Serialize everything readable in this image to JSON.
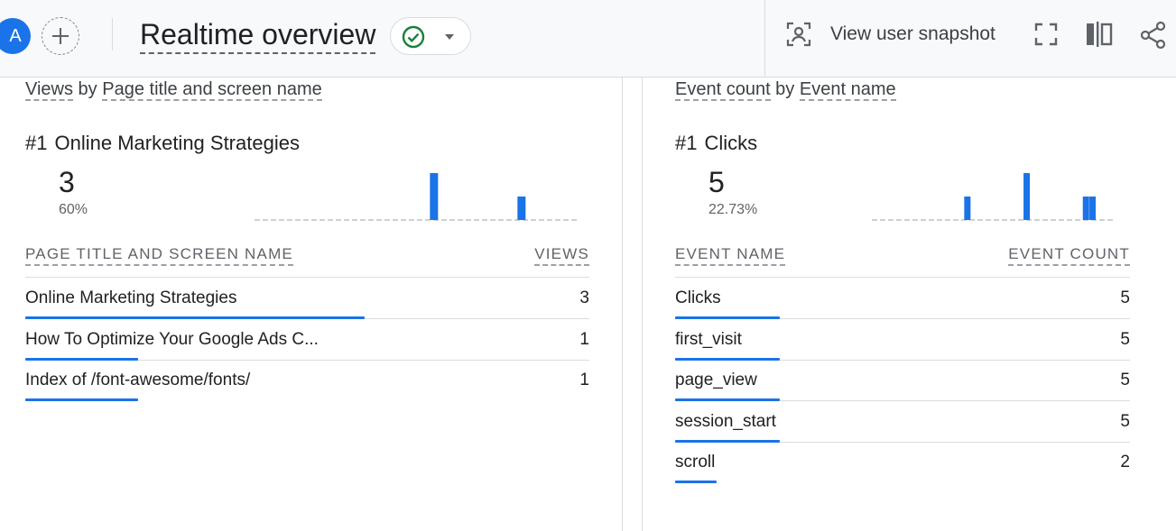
{
  "header": {
    "avatar_letter": "A",
    "title": "Realtime overview",
    "snapshot_label": "View user snapshot"
  },
  "left_card": {
    "title_part1": "Views",
    "title_part2": " by ",
    "title_part3": "Page title and screen name",
    "top_rank": "#1",
    "top_name": "Online Marketing Strategies",
    "top_value": "3",
    "top_percent": "60%",
    "spark_values": [
      0,
      0,
      0,
      0,
      0,
      0,
      0,
      0,
      0,
      0,
      0,
      0,
      0,
      0,
      0,
      0,
      0,
      0,
      0,
      0,
      1,
      0,
      0,
      0,
      0,
      0,
      0,
      0,
      0,
      0,
      0.5,
      0,
      0,
      0,
      0,
      0,
      0
    ],
    "col_name": "PAGE TITLE AND SCREEN NAME",
    "col_value": "VIEWS",
    "rows": [
      {
        "label": "Online Marketing Strategies",
        "count": "3",
        "fraction": 1.0
      },
      {
        "label": "How To Optimize Your Google Ads C...",
        "count": "1",
        "fraction": 0.333
      },
      {
        "label": "Index of /font-awesome/fonts/",
        "count": "1",
        "fraction": 0.333
      }
    ]
  },
  "right_card": {
    "title_part1": "Event count",
    "title_part2": " by ",
    "title_part3": "Event name",
    "top_rank": "#1",
    "top_name": "Clicks",
    "top_value": "5",
    "top_percent": "22.73%",
    "spark_values": [
      0,
      0,
      0,
      0,
      0,
      0,
      0,
      0,
      0,
      0,
      0,
      0,
      0,
      0,
      0.5,
      0,
      0,
      0,
      0,
      0,
      0,
      0,
      0,
      1,
      0,
      0,
      0,
      0,
      0,
      0,
      0,
      0,
      0.5,
      0.5,
      0,
      0,
      0
    ],
    "col_name": "EVENT NAME",
    "col_value": "EVENT COUNT",
    "rows": [
      {
        "label": "Clicks",
        "count": "5",
        "fraction": 1.0
      },
      {
        "label": "first_visit",
        "count": "5",
        "fraction": 1.0
      },
      {
        "label": "page_view",
        "count": "5",
        "fraction": 1.0
      },
      {
        "label": "session_start",
        "count": "5",
        "fraction": 1.0
      },
      {
        "label": "scroll",
        "count": "2",
        "fraction": 0.4
      }
    ]
  },
  "colors": {
    "accent": "#1a73e8",
    "success": "#188038",
    "dashed": "#bdc1c6"
  }
}
